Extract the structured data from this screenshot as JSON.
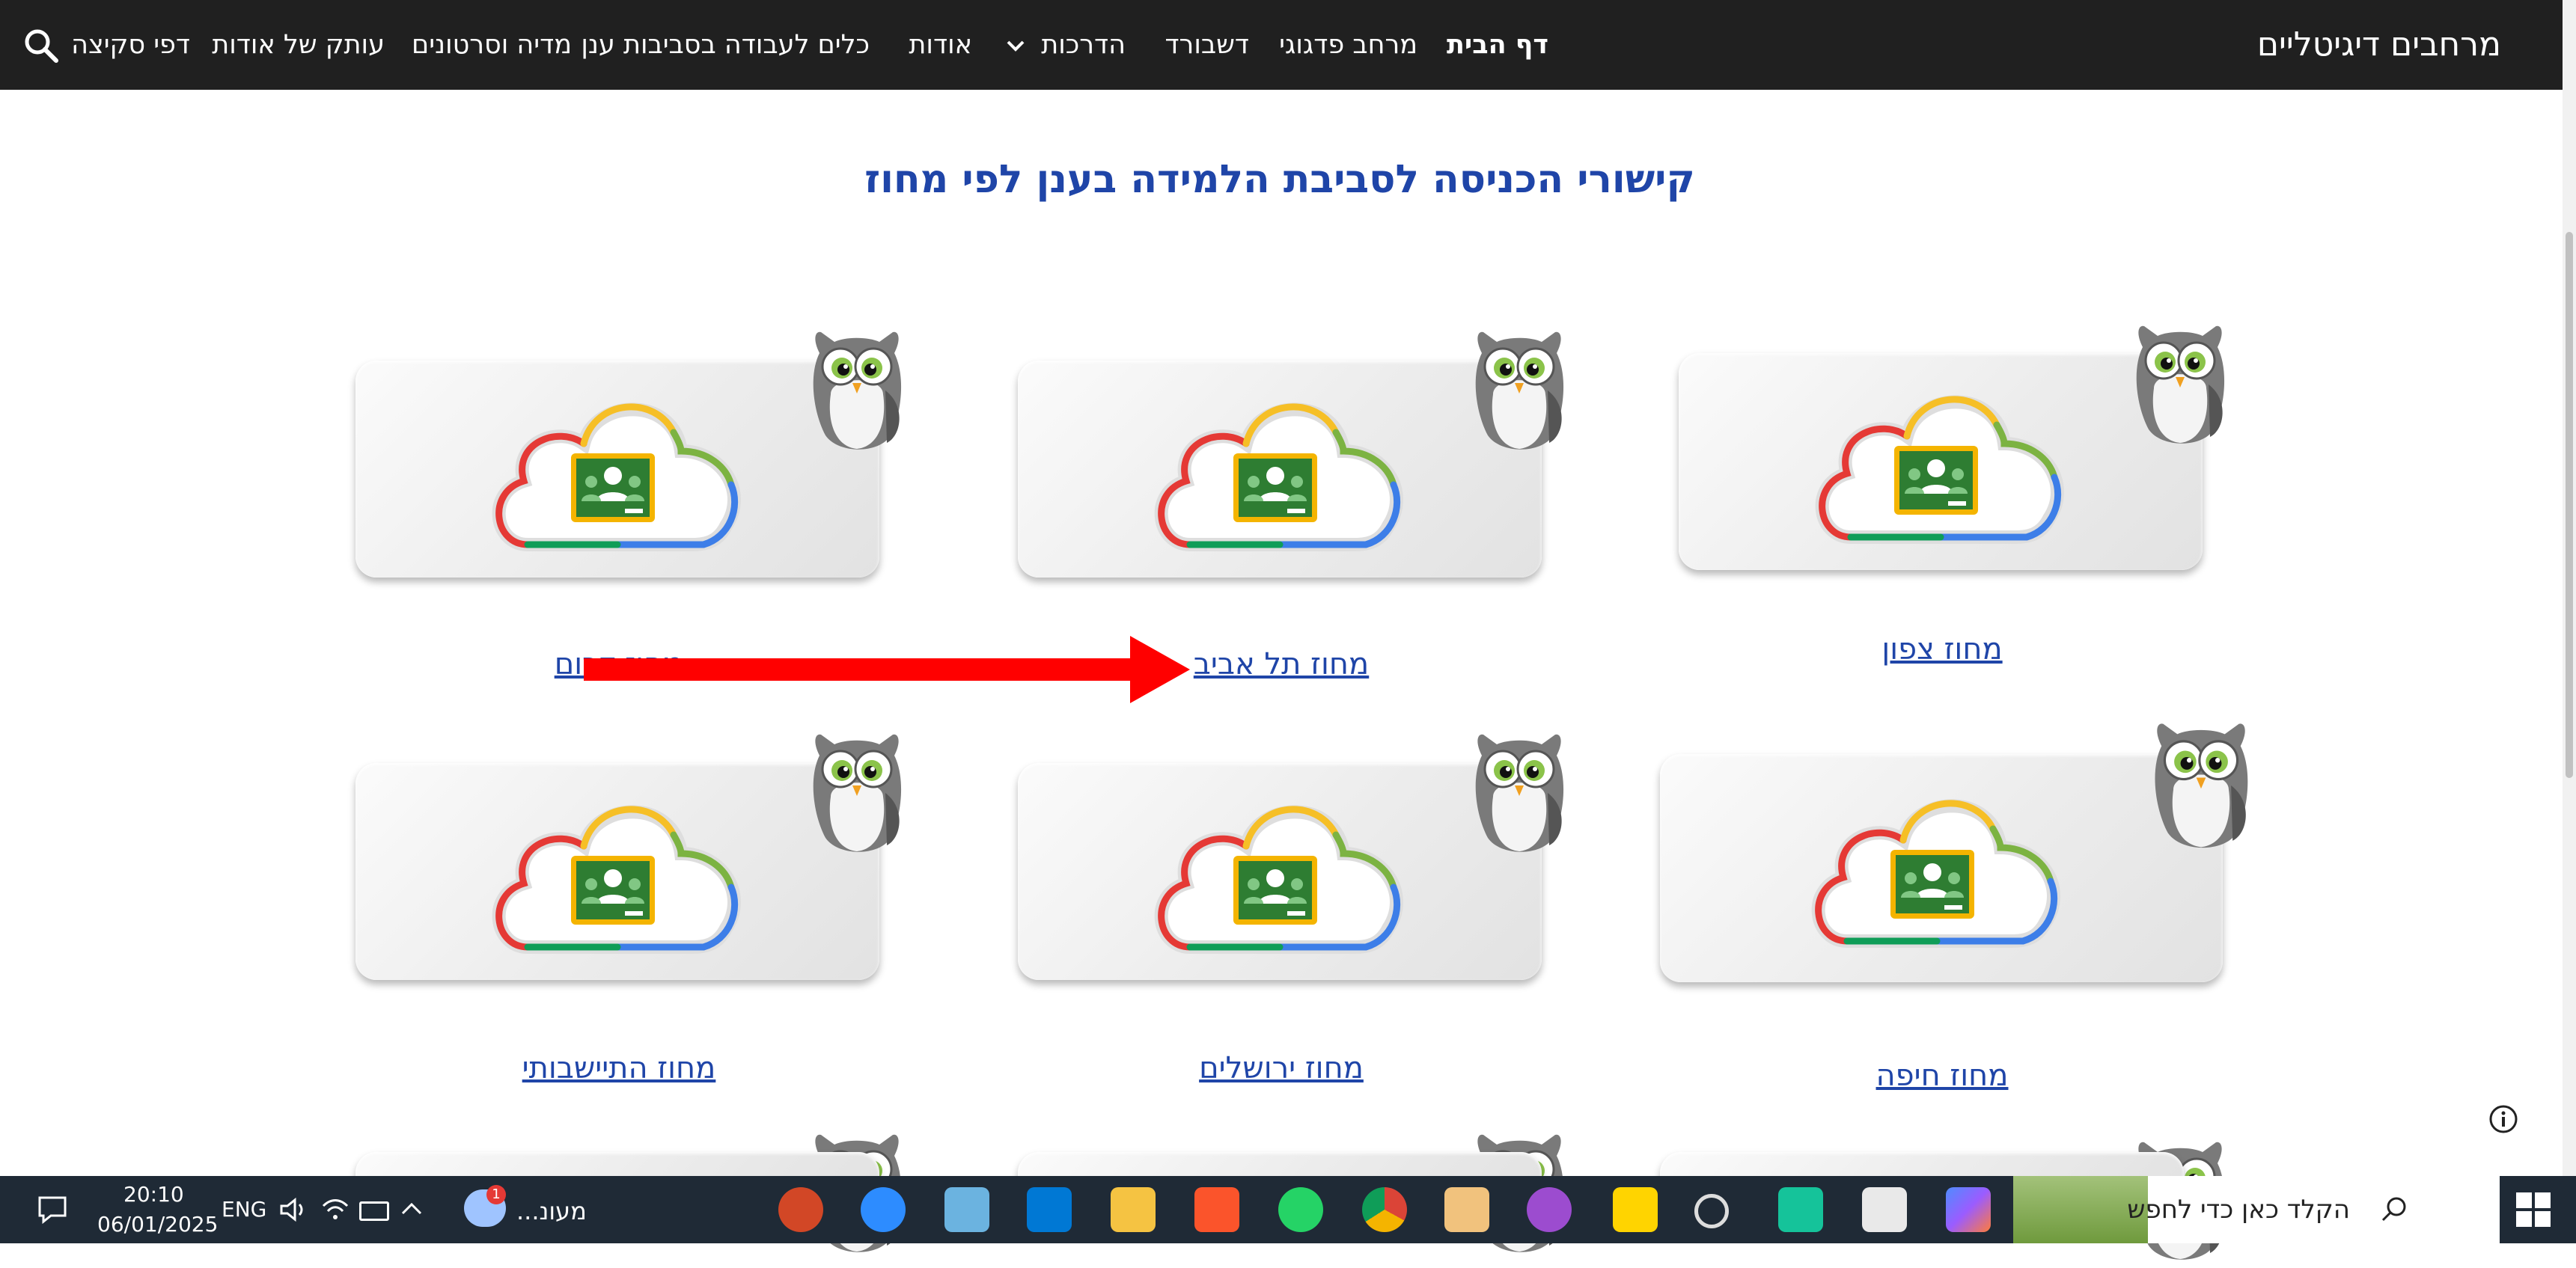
{
  "header": {
    "site_title": "מרחבים דיגיטליים",
    "nav": [
      {
        "label": "דף הבית",
        "bold": true
      },
      {
        "label": "מרחב פדגוגי"
      },
      {
        "label": "דשבורד"
      },
      {
        "label": "הדרכות",
        "has_dropdown": true
      },
      {
        "label": "אודות"
      },
      {
        "label": "כלים לעבודה בסביבות ענן"
      },
      {
        "label": "מדיה וסרטונים"
      },
      {
        "label": "עותק של אודות"
      },
      {
        "label": "דפי סקיצה"
      }
    ],
    "search_icon": "search-icon"
  },
  "main": {
    "heading": "קישורי הכניסה לסביבת הלמידה בענן לפי מחוז",
    "regions": [
      {
        "label": "מחוז צפון"
      },
      {
        "label": "מחוז תל אביב"
      },
      {
        "label": "מחוז דרום"
      },
      {
        "label": "מחוז חיפה"
      },
      {
        "label": "מחוז ירושלים"
      },
      {
        "label": "מחוז התיישבותי"
      }
    ],
    "card_icon": "google-classroom-cloud-icon",
    "mascot_icon": "owl-icon"
  },
  "annotation": {
    "type": "arrow",
    "color": "#ff0000",
    "points_to": "מחוז תל אביב"
  },
  "taskbar": {
    "search_placeholder": "הקלד כאן כדי לחפש",
    "weather_label": "מעונ...",
    "weather_badge": "1",
    "language": "ENG",
    "time": "20:10",
    "date": "06/01/2025",
    "apps": [
      "copilot-icon",
      "snipping-tool-icon",
      "grammarly-icon",
      "settings-icon",
      "sticky-notes-icon",
      "chrome-profile-icon",
      "paint-icon",
      "chrome-icon",
      "whatsapp-icon",
      "brave-icon",
      "file-explorer-icon",
      "vscode-icon",
      "notepad-icon",
      "zoom-icon",
      "powerpoint-icon"
    ]
  },
  "colors": {
    "nav_bg": "#202020",
    "link": "#1f45a8",
    "taskbar_bg": "#1f2a36",
    "arrow": "#ff0000"
  }
}
